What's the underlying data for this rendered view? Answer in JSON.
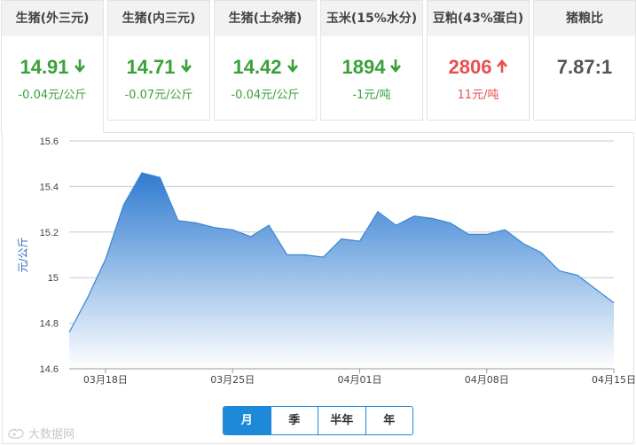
{
  "cards": [
    {
      "title": "生猪(外三元)",
      "price": "14.91",
      "direction": "down",
      "change": "-0.04元/公斤"
    },
    {
      "title": "生猪(内三元)",
      "price": "14.71",
      "direction": "down",
      "change": "-0.07元/公斤"
    },
    {
      "title": "生猪(土杂猪)",
      "price": "14.42",
      "direction": "down",
      "change": "-0.04元/公斤"
    },
    {
      "title": "玉米(15%水分)",
      "price": "1894",
      "direction": "down",
      "change": "-1元/吨"
    },
    {
      "title": "豆粕(43%蛋白)",
      "price": "2806",
      "direction": "up",
      "change": "11元/吨"
    },
    {
      "title": "猪粮比",
      "price": "7.87:1",
      "direction": "none",
      "change": ""
    }
  ],
  "icons": {
    "down": "arrow-down-icon",
    "up": "arrow-up-icon"
  },
  "colors": {
    "down": "#3aa13a",
    "up": "#e84f4f",
    "accent": "#1e88d9",
    "area_top": "#2f7bd0",
    "area_bottom": "#ffffff"
  },
  "period_tabs": [
    {
      "label": "月",
      "selected": true
    },
    {
      "label": "季",
      "selected": false
    },
    {
      "label": "半年",
      "selected": false
    },
    {
      "label": "年",
      "selected": false
    }
  ],
  "watermark": "大数据网",
  "chart_data": {
    "type": "area",
    "ylabel": "元/公斤",
    "xlabel": "",
    "ylim": [
      14.6,
      15.6
    ],
    "yticks": [
      14.6,
      14.8,
      15,
      15.2,
      15.4,
      15.6
    ],
    "ytick_labels": [
      "14.6",
      "14.8",
      "15",
      "15.2",
      "15.4",
      "15.6"
    ],
    "xtick_labels": [
      "03月18日",
      "03月25日",
      "04月01日",
      "04月08日",
      "04月15日"
    ],
    "xtick_dates": [
      "03-18",
      "03-25",
      "04-01",
      "04-08",
      "04-15"
    ],
    "grid": true,
    "x": [
      "03-16",
      "03-17",
      "03-18",
      "03-19",
      "03-20",
      "03-21",
      "03-22",
      "03-23",
      "03-24",
      "03-25",
      "03-26",
      "03-27",
      "03-28",
      "03-29",
      "03-30",
      "03-31",
      "04-01",
      "04-02",
      "04-03",
      "04-04",
      "04-05",
      "04-06",
      "04-07",
      "04-08",
      "04-09",
      "04-10",
      "04-11",
      "04-12",
      "04-13",
      "04-14",
      "04-15"
    ],
    "series": [
      {
        "values": [
          14.76,
          14.91,
          15.08,
          15.32,
          15.46,
          15.44,
          15.25,
          15.24,
          15.22,
          15.21,
          15.18,
          15.23,
          15.1,
          15.1,
          15.09,
          15.17,
          15.16,
          15.29,
          15.23,
          15.27,
          15.26,
          15.24,
          15.19,
          15.19,
          15.21,
          15.15,
          15.11,
          15.03,
          15.01,
          14.95,
          14.89
        ]
      }
    ]
  }
}
